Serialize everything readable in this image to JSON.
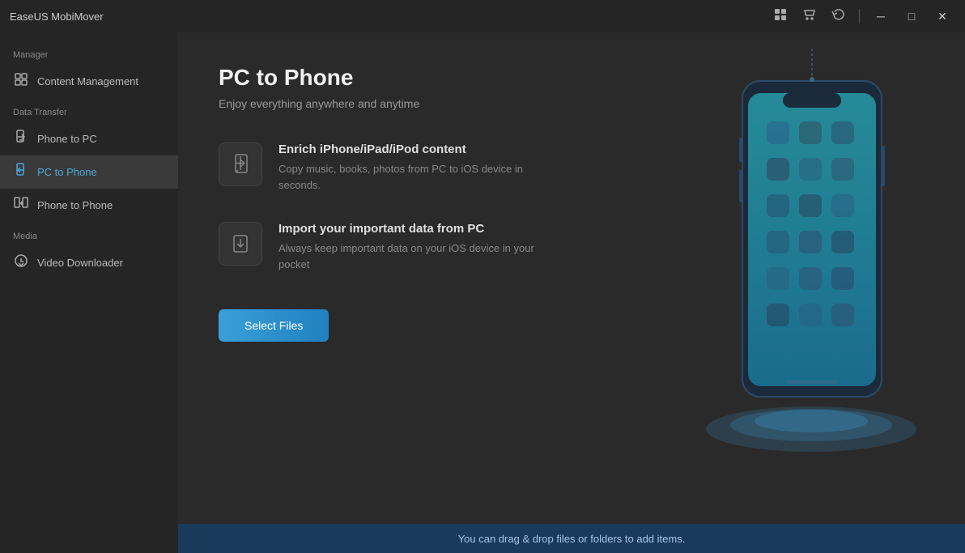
{
  "app": {
    "title": "EaseUS MobiMover"
  },
  "titlebar": {
    "icons": [
      "settings-icon",
      "store-icon",
      "download-icon"
    ],
    "controls": {
      "minimize": "─",
      "maximize": "□",
      "close": "✕"
    }
  },
  "sidebar": {
    "manager_label": "Manager",
    "manager_items": [
      {
        "id": "content-management",
        "label": "Content Management",
        "icon": "⊞"
      }
    ],
    "data_transfer_label": "Data Transfer",
    "data_transfer_items": [
      {
        "id": "phone-to-pc",
        "label": "Phone to PC",
        "icon": "📱",
        "active": false
      },
      {
        "id": "pc-to-phone",
        "label": "PC to Phone",
        "icon": "💻",
        "active": true
      },
      {
        "id": "phone-to-phone",
        "label": "Phone to Phone",
        "icon": "📲",
        "active": false
      }
    ],
    "media_label": "Media",
    "media_items": [
      {
        "id": "video-downloader",
        "label": "Video Downloader",
        "icon": "⬇"
      }
    ]
  },
  "content": {
    "page_title": "PC to Phone",
    "page_subtitle": "Enjoy everything anywhere and anytime",
    "features": [
      {
        "id": "enrich",
        "title": "Enrich iPhone/iPad/iPod content",
        "description": "Copy music, books, photos from PC to iOS device in seconds."
      },
      {
        "id": "import",
        "title": "Import your important data from PC",
        "description": "Always keep important data on your iOS device in your pocket"
      }
    ],
    "select_button": "Select Files",
    "bottom_message": "You can drag & drop files or folders to add items."
  }
}
